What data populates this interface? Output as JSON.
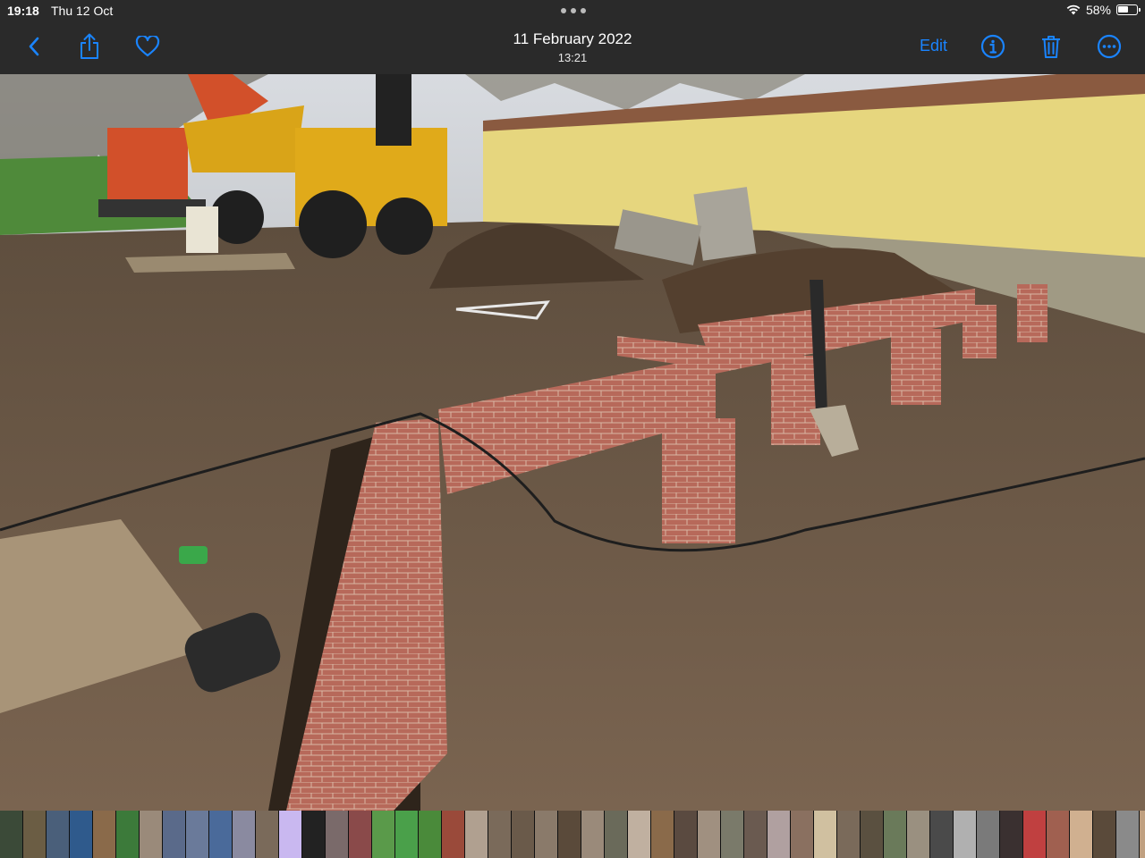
{
  "status": {
    "time": "19:18",
    "date": "Thu 12 Oct",
    "battery": "58%",
    "battery_level": 0.58
  },
  "toolbar": {
    "title": "11 February 2022",
    "subtitle": "13:21",
    "edit_label": "Edit",
    "icons": [
      "back-chevron-icon",
      "share-icon",
      "heart-icon",
      "info-icon",
      "trash-icon",
      "more-icon"
    ]
  },
  "colors": {
    "accent": "#1a84ff",
    "bar_bg": "#2a2a2a"
  },
  "filmstrip": {
    "thumbs": [
      "#3b4a38",
      "#6b5d44",
      "#4a5f7a",
      "#2f5a8c",
      "#8a6a4a",
      "#3c7a3a",
      "#9a8a7a",
      "#5a6a8a",
      "#6a7a9a",
      "#4a6a9a",
      "#8a8aa0",
      "#7a6a5a",
      "#c9b8f0",
      "#222222",
      "#7a6a6a",
      "#8a4a4a",
      "#5a9a4a",
      "#4aa04a",
      "#4a8a3a",
      "#9a4a3a",
      "#b0a090",
      "#7a6a5a",
      "#6a5a4a",
      "#8a7a6a",
      "#5a4a3a",
      "#9a8a7a",
      "#6a6a5a",
      "#c0b0a0",
      "#8a6a4a",
      "#5a4a40",
      "#a09080",
      "#7a7a6a",
      "#6a5a50",
      "#b0a0a0",
      "#8a7060",
      "#d0c0a0",
      "#7a6a5a",
      "#5a5040",
      "#6a7a5a",
      "#9a9080",
      "#4a4a4a",
      "#b0b0b0",
      "#7a7a7a",
      "#3a3030",
      "#c04040",
      "#a06050",
      "#d0b090",
      "#5a4a3a",
      "#8a8a8a",
      "#c0a080",
      "#6a5a4a",
      "#9a7a6a",
      "#b09070",
      "#7a6a5a",
      "#c0b0a0",
      "#5a6a7a",
      "#8a9aa0",
      "#6a6a6a",
      "#a09080"
    ]
  }
}
